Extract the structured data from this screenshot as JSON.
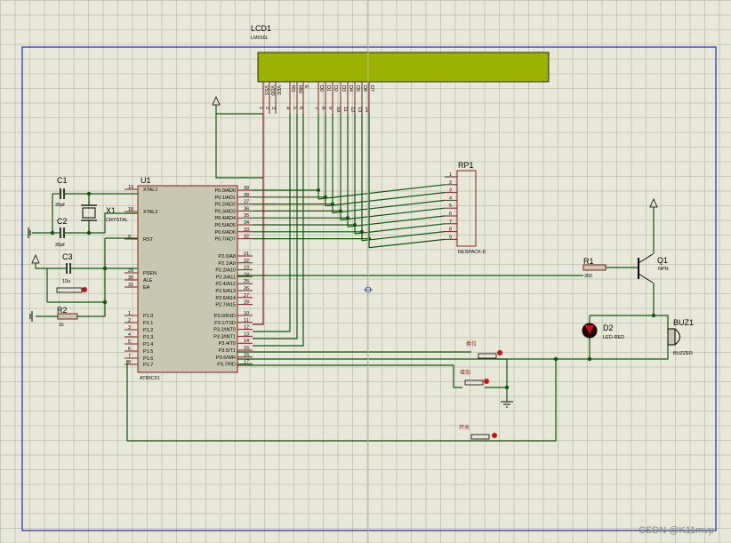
{
  "lcd": {
    "ref": "LCD1",
    "model": "LM016L",
    "pins": [
      {
        "name": "VSS",
        "num": "1"
      },
      {
        "name": "VDD",
        "num": "2"
      },
      {
        "name": "VEE",
        "num": "3"
      },
      {
        "name": "RS",
        "num": "4"
      },
      {
        "name": "RW",
        "num": "5"
      },
      {
        "name": "E",
        "num": "6"
      },
      {
        "name": "D0",
        "num": "7"
      },
      {
        "name": "D1",
        "num": "8"
      },
      {
        "name": "D2",
        "num": "9"
      },
      {
        "name": "D3",
        "num": "10"
      },
      {
        "name": "D4",
        "num": "11"
      },
      {
        "name": "D5",
        "num": "12"
      },
      {
        "name": "D6",
        "num": "13"
      },
      {
        "name": "D7",
        "num": "14"
      }
    ],
    "screen_color": "#9bb300"
  },
  "mcu": {
    "ref": "U1",
    "model": "AT89C51",
    "left_pins": [
      {
        "num": "19",
        "name": "XTAL1"
      },
      {
        "num": "18",
        "name": "XTAL2"
      },
      {
        "num": "9",
        "name": "RST"
      },
      {
        "num": "29",
        "name": "PSEN"
      },
      {
        "num": "30",
        "name": "ALE"
      },
      {
        "num": "31",
        "name": "EA"
      },
      {
        "num": "1",
        "name": "P1.0"
      },
      {
        "num": "2",
        "name": "P1.1"
      },
      {
        "num": "3",
        "name": "P1.2"
      },
      {
        "num": "4",
        "name": "P1.3"
      },
      {
        "num": "5",
        "name": "P1.4"
      },
      {
        "num": "6",
        "name": "P1.5"
      },
      {
        "num": "7",
        "name": "P1.6"
      },
      {
        "num": "8",
        "name": "P1.7"
      }
    ],
    "right_pins": [
      {
        "num": "39",
        "name": "P0.0/AD0"
      },
      {
        "num": "38",
        "name": "P0.1/AD1"
      },
      {
        "num": "37",
        "name": "P0.2/AD2"
      },
      {
        "num": "36",
        "name": "P0.3/AD3"
      },
      {
        "num": "35",
        "name": "P0.4/AD4"
      },
      {
        "num": "34",
        "name": "P0.5/AD5"
      },
      {
        "num": "33",
        "name": "P0.6/AD6"
      },
      {
        "num": "32",
        "name": "P0.7/AD7"
      },
      {
        "num": "21",
        "name": "P2.0/A8"
      },
      {
        "num": "22",
        "name": "P2.1/A9"
      },
      {
        "num": "23",
        "name": "P2.2/A10"
      },
      {
        "num": "24",
        "name": "P2.3/A11"
      },
      {
        "num": "25",
        "name": "P2.4/A12"
      },
      {
        "num": "26",
        "name": "P2.5/A13"
      },
      {
        "num": "27",
        "name": "P2.6/A14"
      },
      {
        "num": "28",
        "name": "P2.7/A15"
      },
      {
        "num": "10",
        "name": "P3.0/RXD"
      },
      {
        "num": "11",
        "name": "P3.1/TXD"
      },
      {
        "num": "12",
        "name": "P3.2/INT0"
      },
      {
        "num": "13",
        "name": "P3.3/INT1"
      },
      {
        "num": "14",
        "name": "P3.4/T0"
      },
      {
        "num": "15",
        "name": "P3.5/T1"
      },
      {
        "num": "16",
        "name": "P3.6/WR"
      },
      {
        "num": "17",
        "name": "P3.7/RD"
      }
    ]
  },
  "rp": {
    "ref": "RP1",
    "model": "RESPACK-8",
    "pins": [
      "1",
      "2",
      "3",
      "4",
      "5",
      "6",
      "7",
      "8",
      "9"
    ]
  },
  "c1": {
    "ref": "C1",
    "value": "30pf"
  },
  "c2": {
    "ref": "C2",
    "value": "30pf"
  },
  "c3": {
    "ref": "C3",
    "value": "10u"
  },
  "x1": {
    "ref": "X1",
    "model": "CRYSTAL"
  },
  "r2": {
    "ref": "R2",
    "value": "1k"
  },
  "r1": {
    "ref": "R1",
    "value": "300"
  },
  "q1": {
    "ref": "Q1",
    "model": "NPN"
  },
  "d2": {
    "ref": "D2",
    "model": "LED-RED"
  },
  "buz": {
    "ref": "BUZ1",
    "model": "BUZZER"
  },
  "buttons": {
    "shift": "换位",
    "add": "增加",
    "power": "开关"
  },
  "watermark": "CSDN @K11mvp"
}
